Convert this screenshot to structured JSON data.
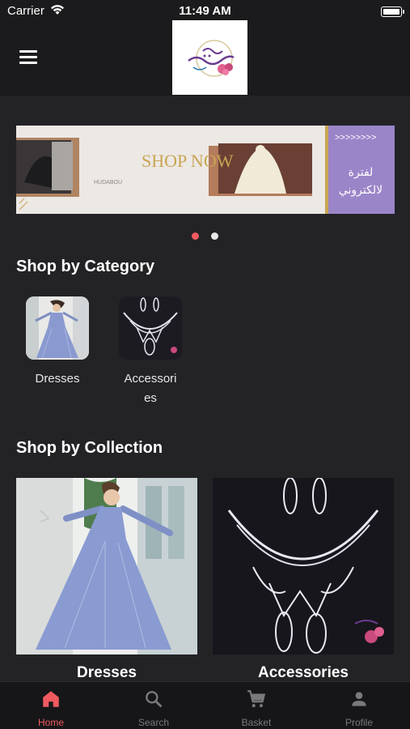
{
  "status_bar": {
    "carrier": "Carrier",
    "time": "11:49 AM"
  },
  "banner": {
    "headline": "SHOP NOW",
    "brand": "HUDABOU",
    "side_text_line1": "لفترة",
    "side_text_line2": "لالكتروني",
    "active_slide": 1,
    "slides": 2
  },
  "sections": {
    "category_title": "Shop by Category",
    "collection_title": "Shop by Collection"
  },
  "categories": [
    {
      "label": "Dresses",
      "icon": "dress-photo"
    },
    {
      "label": "Accessori\nes",
      "icon": "necklace-photo"
    }
  ],
  "collections": [
    {
      "label": "Dresses",
      "icon": "dress-photo"
    },
    {
      "label": "Accessories",
      "icon": "necklace-photo"
    }
  ],
  "tabs": [
    {
      "label": "Home",
      "icon": "home-icon",
      "active": true
    },
    {
      "label": "Search",
      "icon": "search-icon",
      "active": false
    },
    {
      "label": "Basket",
      "icon": "cart-icon",
      "active": false
    },
    {
      "label": "Profile",
      "icon": "person-icon",
      "active": false
    }
  ],
  "colors": {
    "accent": "#ef5a60",
    "background": "#232326",
    "bar": "#1b1b1d",
    "banner_purple": "#9b85c9",
    "banner_gold": "#c9a552"
  }
}
